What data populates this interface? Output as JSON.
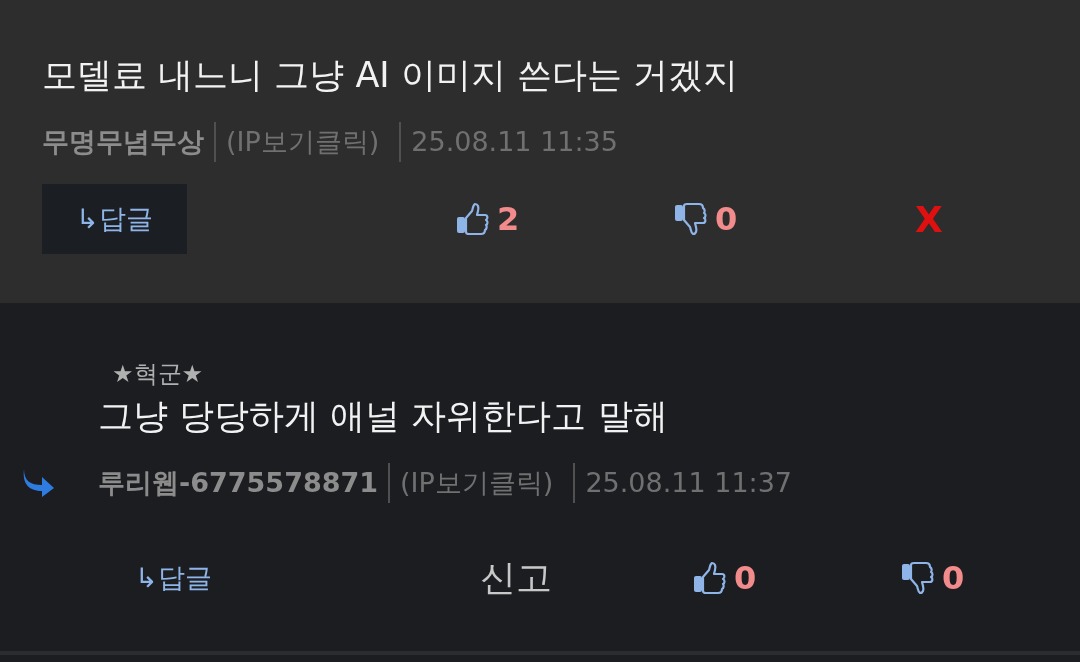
{
  "comments": [
    {
      "kind": "comment",
      "text": "모델료 내느니 그냥 AI 이미지 쓴다는 거겠지",
      "author": "무명무념무상",
      "ip": "(IP보기클릭)",
      "time": "25.08.11 11:35",
      "reply_label": "↳답글",
      "extra": {
        "kind": "delete",
        "label": "X"
      },
      "likes": "2",
      "dislikes": "0"
    },
    {
      "kind": "reply",
      "badge": "★혁군★",
      "text": "그냥 당당하게 애널 자위한다고 말해",
      "author": "루리웹-6775578871",
      "ip": "(IP보기클릭)",
      "time": "25.08.11 11:37",
      "reply_label": "↳답글",
      "extra": {
        "kind": "report",
        "label": "신고"
      },
      "likes": "0",
      "dislikes": "0"
    }
  ]
}
